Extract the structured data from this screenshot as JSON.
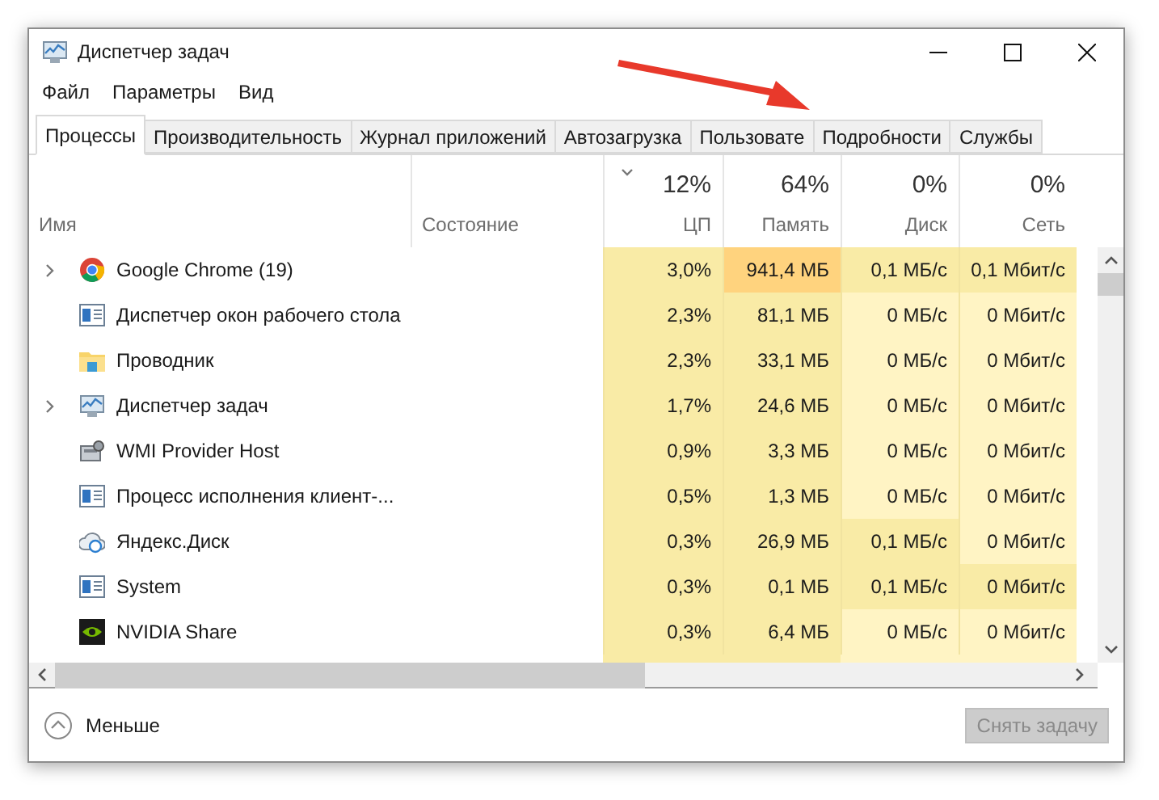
{
  "window": {
    "title": "Диспетчер задач"
  },
  "menu": [
    "Файл",
    "Параметры",
    "Вид"
  ],
  "tabs": [
    {
      "label": "Процессы",
      "selected": true
    },
    {
      "label": "Производительность",
      "selected": false
    },
    {
      "label": "Журнал приложений",
      "selected": false
    },
    {
      "label": "Автозагрузка",
      "selected": false
    },
    {
      "label": "Пользовате",
      "selected": false
    },
    {
      "label": "Подробности",
      "selected": false
    },
    {
      "label": "Службы",
      "selected": false
    }
  ],
  "table": {
    "columns": [
      {
        "label": "Имя"
      },
      {
        "label": "Состояние"
      },
      {
        "percent": "12%",
        "label": "ЦП",
        "sorted": true
      },
      {
        "percent": "64%",
        "label": "Память"
      },
      {
        "percent": "0%",
        "label": "Диск"
      },
      {
        "percent": "0%",
        "label": "Сеть"
      }
    ],
    "rows": [
      {
        "expandable": true,
        "cells": [
          {
            "value": "Google Chrome (19)"
          },
          {},
          {
            "value": "3,0%",
            "color": "#f9eba6"
          },
          {
            "value": "941,4 МБ",
            "color": "#ffd37e"
          },
          {
            "value": "0,1 МБ/с",
            "color": "#f9eba6"
          },
          {
            "value": "0,1 Мбит/с",
            "color": "#f9eba6"
          }
        ]
      },
      {
        "cells": [
          {
            "value": "Диспетчер окон рабочего стола"
          },
          {},
          {
            "value": "2,3%",
            "color": "#f9eba6"
          },
          {
            "value": "81,1 МБ",
            "color": "#f9eba6"
          },
          {
            "value": "0 МБ/с",
            "color": "#fff4c4"
          },
          {
            "value": "0 Мбит/с",
            "color": "#fff4c4"
          }
        ]
      },
      {
        "cells": [
          {
            "value": "Проводник"
          },
          {},
          {
            "value": "2,3%",
            "color": "#f9eba6"
          },
          {
            "value": "33,1 МБ",
            "color": "#f9eba6"
          },
          {
            "value": "0 МБ/с",
            "color": "#fff4c4"
          },
          {
            "value": "0 Мбит/с",
            "color": "#fff4c4"
          }
        ]
      },
      {
        "expandable": true,
        "cells": [
          {
            "value": "Диспетчер задач"
          },
          {},
          {
            "value": "1,7%",
            "color": "#f9eba6"
          },
          {
            "value": "24,6 МБ",
            "color": "#f9eba6"
          },
          {
            "value": "0 МБ/с",
            "color": "#fff4c4"
          },
          {
            "value": "0 Мбит/с",
            "color": "#fff4c4"
          }
        ]
      },
      {
        "cells": [
          {
            "value": "WMI Provider Host"
          },
          {},
          {
            "value": "0,9%",
            "color": "#f9eba6"
          },
          {
            "value": "3,3 МБ",
            "color": "#f9eba6"
          },
          {
            "value": "0 МБ/с",
            "color": "#fff4c4"
          },
          {
            "value": "0 Мбит/с",
            "color": "#fff4c4"
          }
        ]
      },
      {
        "cells": [
          {
            "value": "Процесс исполнения клиент-..."
          },
          {},
          {
            "value": "0,5%",
            "color": "#f9eba6"
          },
          {
            "value": "1,3 МБ",
            "color": "#f9eba6"
          },
          {
            "value": "0 МБ/с",
            "color": "#fff4c4"
          },
          {
            "value": "0 Мбит/с",
            "color": "#fff4c4"
          }
        ]
      },
      {
        "cells": [
          {
            "value": "Яндекс.Диск"
          },
          {},
          {
            "value": "0,3%",
            "color": "#f9eba6"
          },
          {
            "value": "26,9 МБ",
            "color": "#f9eba6"
          },
          {
            "value": "0,1 МБ/с",
            "color": "#f9eba6"
          },
          {
            "value": "0 Мбит/с",
            "color": "#fff4c4"
          }
        ]
      },
      {
        "cells": [
          {
            "value": "System"
          },
          {},
          {
            "value": "0,3%",
            "color": "#f9eba6"
          },
          {
            "value": "0,1 МБ",
            "color": "#f9eba6"
          },
          {
            "value": "0,1 МБ/с",
            "color": "#f9eba6"
          },
          {
            "value": "0 Мбит/с",
            "color": "#f9eba6"
          }
        ]
      },
      {
        "cells": [
          {
            "value": "NVIDIA Share"
          },
          {},
          {
            "value": "0,3%",
            "color": "#f9eba6"
          },
          {
            "value": "6,4 МБ",
            "color": "#f9eba6"
          },
          {
            "value": "0 МБ/с",
            "color": "#fff4c4"
          },
          {
            "value": "0 Мбит/с",
            "color": "#fff4c4"
          }
        ]
      }
    ]
  },
  "footer": {
    "toggle": "Меньше",
    "button": {
      "label": "Снять задачу",
      "disabled": true
    }
  }
}
